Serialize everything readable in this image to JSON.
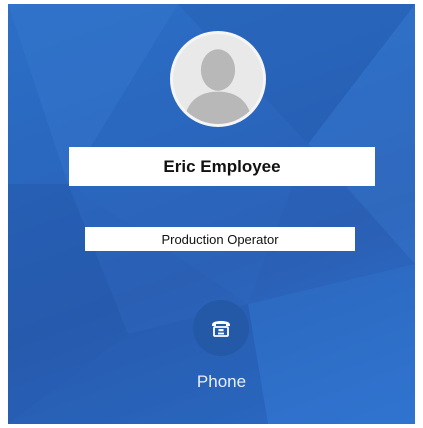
{
  "employee": {
    "name": "Eric Employee",
    "title": "Production Operator",
    "avatar_icon": "person-silhouette-icon"
  },
  "actions": {
    "phone": {
      "label": "Phone",
      "icon": "telephone-icon"
    }
  },
  "colors": {
    "background": "#2a66bd",
    "action_circle": "#2459a8",
    "box": "#ffffff",
    "text": "#111111"
  }
}
